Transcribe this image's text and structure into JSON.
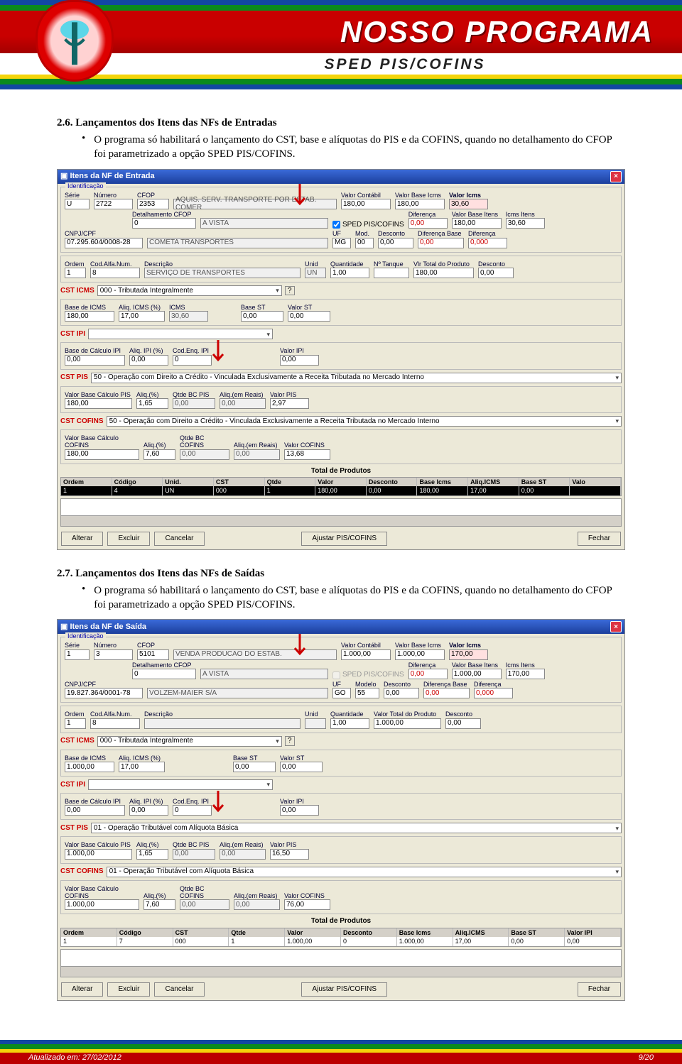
{
  "header": {
    "title": "NOSSO PROGRAMA",
    "subtitle": "SPED PIS/COFINS"
  },
  "section26": {
    "heading": "2.6. Lançamentos dos Itens das NFs de Entradas",
    "bullet": "O programa só habilitará o lançamento do CST, base e alíquotas do PIS e da COFINS, quando no detalhamento do CFOP foi parametrizado a opção SPED PIS/COFINS."
  },
  "section27": {
    "heading": "2.7. Lançamentos dos Itens das NFs de Saídas",
    "bullet": "O programa só habilitará o lançamento do CST, base e alíquotas do PIS e da COFINS, quando no detalhamento do CFOP foi parametrizado a opção SPED PIS/COFINS."
  },
  "app1": {
    "title": "Itens da NF de Entrada",
    "ident": {
      "serie_lbl": "Série",
      "serie": "U",
      "numero_lbl": "Número",
      "numero": "2722",
      "cfop_lbl": "CFOP",
      "cfop": "2353",
      "cfop_desc": "AQUIS. SERV. TRANSPORTE POR ESTAB. COMER",
      "det_lbl": "Detalhamento CFOP",
      "det_num": "0",
      "det_desc": "A VISTA",
      "chk": "SPED PIS/COFINS",
      "cnpj_lbl": "CNPJ/CPF",
      "cnpj": "07.295.604/0008-28",
      "empresa": "COMETA TRANSPORTES",
      "vcontab_lbl": "Valor Contábil",
      "vcontab": "180,00",
      "vbi_lbl": "Valor Base Icms",
      "vbi": "180,00",
      "vicms_lbl": "Valor Icms",
      "vicms": "30,60",
      "dif_lbl": "Diferença",
      "dif": "0,00",
      "vbit_lbl": "Valor Base Itens",
      "vbit": "180,00",
      "icmsit_lbl": "Icms Itens",
      "icmsit": "30,60",
      "uf_lbl": "UF",
      "uf": "MG",
      "mod_lbl": "Mod.",
      "mod": "00",
      "desc_lbl": "Desconto",
      "desc": "0,00",
      "difb_lbl": "Diferença Base",
      "difb": "0,00",
      "dift_lbl": "Diferença",
      "dift": "0,000"
    },
    "item": {
      "ordem_lbl": "Ordem",
      "ordem": "1",
      "cod_lbl": "Cod.Alfa.Num.",
      "cod": "8",
      "desc_lbl": "Descrição",
      "desc": "SERVIÇO DE TRANSPORTES",
      "unid_lbl": "Unid",
      "unid": "UN",
      "q_lbl": "Quantidade",
      "q": "1,00",
      "nt_lbl": "Nº Tanque",
      "nt": "",
      "vtp_lbl": "Vlr Total do Produto",
      "vtp": "180,00",
      "ditem_lbl": "Desconto",
      "ditem": "0,00"
    },
    "cst_icms": {
      "hdr": "CST ICMS",
      "dd": "000 - Tributada Integralmente",
      "base_lbl": "Base de ICMS",
      "base": "180,00",
      "aliq_lbl": "Aliq. ICMS (%)",
      "aliq": "17,00",
      "icms_lbl": "ICMS",
      "icms": "30,60",
      "bst_lbl": "Base ST",
      "bst": "0,00",
      "vst_lbl": "Valor ST",
      "vst": "0,00"
    },
    "cst_ipi": {
      "hdr": "CST IPI",
      "dd": "",
      "base_lbl": "Base de Cálculo IPI",
      "base": "0,00",
      "aliq_lbl": "Aliq. IPI (%)",
      "aliq": "0,00",
      "ceq_lbl": "Cod.Enq. IPI",
      "ceq": "0",
      "vipi_lbl": "Valor IPI",
      "vipi": "0,00"
    },
    "cst_pis": {
      "hdr": "CST PIS",
      "dd": "50 - Operação com Direito a Crédito - Vinculada Exclusivamente a Receita Tributada no Mercado Interno",
      "base_lbl": "Valor Base Cálculo PIS",
      "base": "180,00",
      "aliq_lbl": "Aliq.(%)",
      "aliq": "1,65",
      "qbc_lbl": "Qtde BC PIS",
      "qbc": "0,00",
      "ar_lbl": "Aliq.(em Reais)",
      "ar": "0,00",
      "val_lbl": "Valor PIS",
      "val": "2,97"
    },
    "cst_cofins": {
      "hdr": "CST COFINS",
      "dd": "50 - Operação com Direito a Crédito - Vinculada Exclusivamente a Receita Tributada no Mercado Interno",
      "base_lbl": "Valor Base Cálculo COFINS",
      "base": "180,00",
      "aliq_lbl": "Aliq.(%)",
      "aliq": "7,60",
      "qbc_lbl": "Qtde BC COFINS",
      "qbc": "0,00",
      "ar_lbl": "Aliq.(em Reais)",
      "ar": "0,00",
      "val_lbl": "Valor COFINS",
      "val": "13,68"
    },
    "totals": {
      "title": "Total de Produtos",
      "cols": [
        "Ordem",
        "Código",
        "Unid.",
        "CST",
        "Qtde",
        "Valor",
        "Desconto",
        "Base Icms",
        "Aliq.ICMS",
        "Base ST",
        "Valo"
      ],
      "row": [
        "1",
        "4",
        "UN",
        "000",
        "1",
        "180,00",
        "0,00",
        "180,00",
        "17,00",
        "0,00",
        ""
      ]
    },
    "buttons": {
      "alt": "Alterar",
      "exc": "Excluir",
      "can": "Cancelar",
      "ajp": "Ajustar PIS/COFINS",
      "fec": "Fechar"
    }
  },
  "app2": {
    "title": "Itens da NF de Saída",
    "ident": {
      "serie": "1",
      "numero": "3",
      "cfop": "5101",
      "cfop_desc": "VENDA PRODUCAO DO ESTAB.",
      "det_num": "0",
      "det_desc": "A VISTA",
      "chk": "SPED PIS/COFINS",
      "cnpj": "19.827.364/0001-78",
      "empresa": "VOLZEM-MAIER S/A",
      "vcontab": "1.000,00",
      "vbi": "1.000,00",
      "vicms": "170,00",
      "dif": "0,00",
      "vbit": "1.000,00",
      "icmsit": "170,00",
      "uf": "GO",
      "mod": "55",
      "desc": "0,00",
      "difb": "0,00",
      "dift": "0,000"
    },
    "item": {
      "ordem": "1",
      "cod": "8",
      "desc": "",
      "unid": "",
      "q": "1,00",
      "vtp": "1.000,00",
      "ditem": "0,00",
      "vtp_lbl": "Valor Total do Produto"
    },
    "cst_icms": {
      "dd": "000 - Tributada Integralmente",
      "base": "1.000,00",
      "aliq": "17,00",
      "bst": "0,00",
      "vst": "0,00"
    },
    "cst_ipi": {
      "dd": "",
      "base": "0,00",
      "aliq": "0,00",
      "ceq": "0",
      "vipi": "0,00"
    },
    "cst_pis": {
      "dd": "01 - Operação Tributável com Alíquota Básica",
      "base": "1.000,00",
      "aliq": "1,65",
      "qbc": "0,00",
      "ar": "0,00",
      "val": "16,50"
    },
    "cst_cofins": {
      "dd": "01 - Operação Tributável com Alíquota Básica",
      "base": "1.000,00",
      "aliq": "7,60",
      "qbc": "0,00",
      "ar": "0,00",
      "val": "76,00"
    },
    "totals": {
      "cols": [
        "Ordem",
        "Código",
        "CST",
        "Qtde",
        "Valor",
        "Desconto",
        "Base Icms",
        "Aliq.ICMS",
        "Base ST",
        "Valor IPI"
      ],
      "row": [
        "1",
        "7",
        "000",
        "1",
        "1.000,00",
        "0",
        "1.000,00",
        "17,00",
        "0,00",
        "0,00"
      ]
    }
  },
  "footer": {
    "updated": "Atualizado em: 27/02/2012",
    "page": "9/20"
  }
}
